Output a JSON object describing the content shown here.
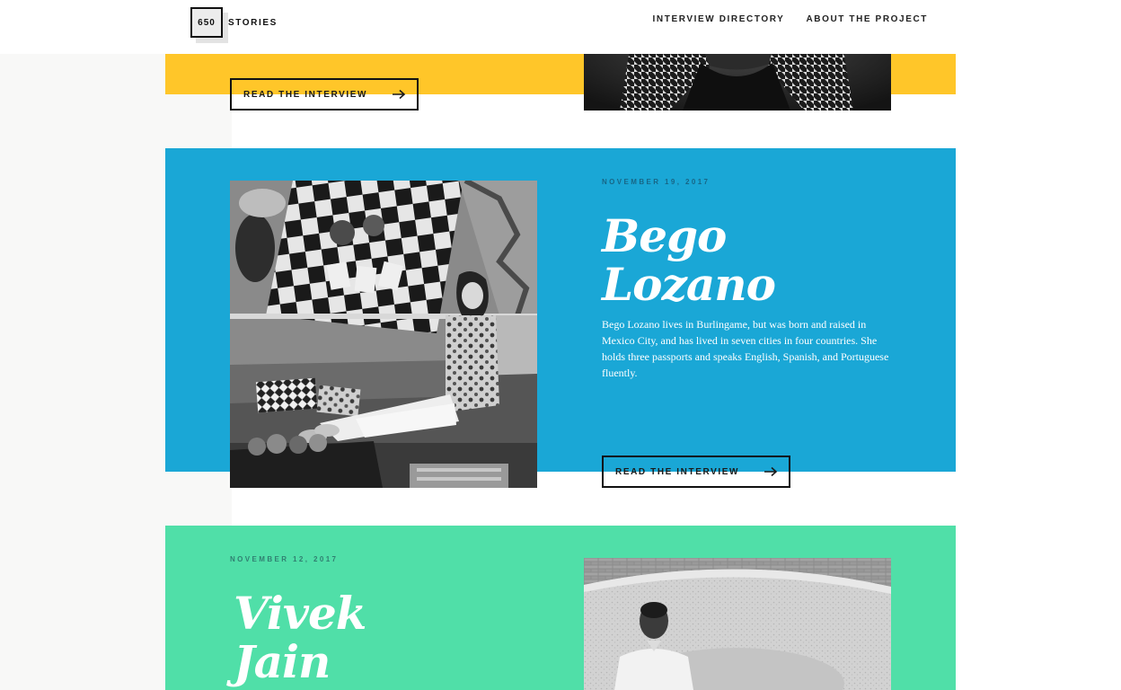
{
  "site": {
    "logo_number": "650",
    "logo_word": "STORIES",
    "nav": [
      "INTERVIEW DIRECTORY",
      "ABOUT THE PROJECT"
    ]
  },
  "colors": {
    "yellow": "#ffc629",
    "blue": "#1aa7d6",
    "green": "#50dfa8"
  },
  "stories": [
    {
      "button_label": "READ THE INTERVIEW"
    },
    {
      "date": "NOVEMBER 19, 2017",
      "name_line1": "Bego",
      "name_line2": "Lozano",
      "bio": "Bego Lozano lives in Burlingame, but was born and raised in Mexico City, and has lived in seven cities in four countries. She holds three passports and speaks English, Spanish, and Portuguese fluently.",
      "button_label": "READ THE INTERVIEW"
    },
    {
      "date": "NOVEMBER 12, 2017",
      "name_line1": "Vivek",
      "name_line2": "Jain"
    }
  ]
}
